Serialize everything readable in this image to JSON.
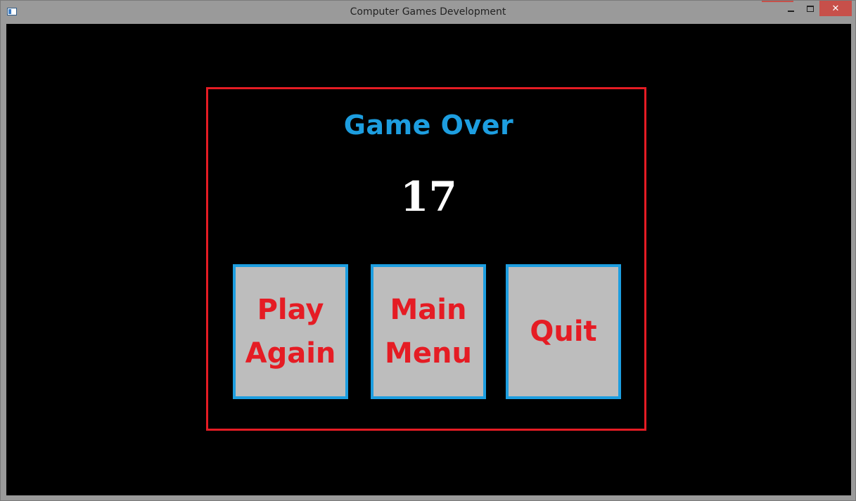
{
  "window": {
    "title": "Computer Games Development",
    "close_glyph": "✕"
  },
  "game": {
    "heading": "Game Over",
    "score": "17",
    "buttons": {
      "play_again": "Play\nAgain",
      "main_menu": "Main\nMenu",
      "quit": "Quit"
    }
  },
  "colors": {
    "panel_border": "#e51c24",
    "button_border": "#1d9ee0",
    "button_fill": "#bdbdbd",
    "button_text": "#e51c24",
    "heading": "#1d9ee0",
    "score": "#ffffff",
    "background": "#000000"
  }
}
